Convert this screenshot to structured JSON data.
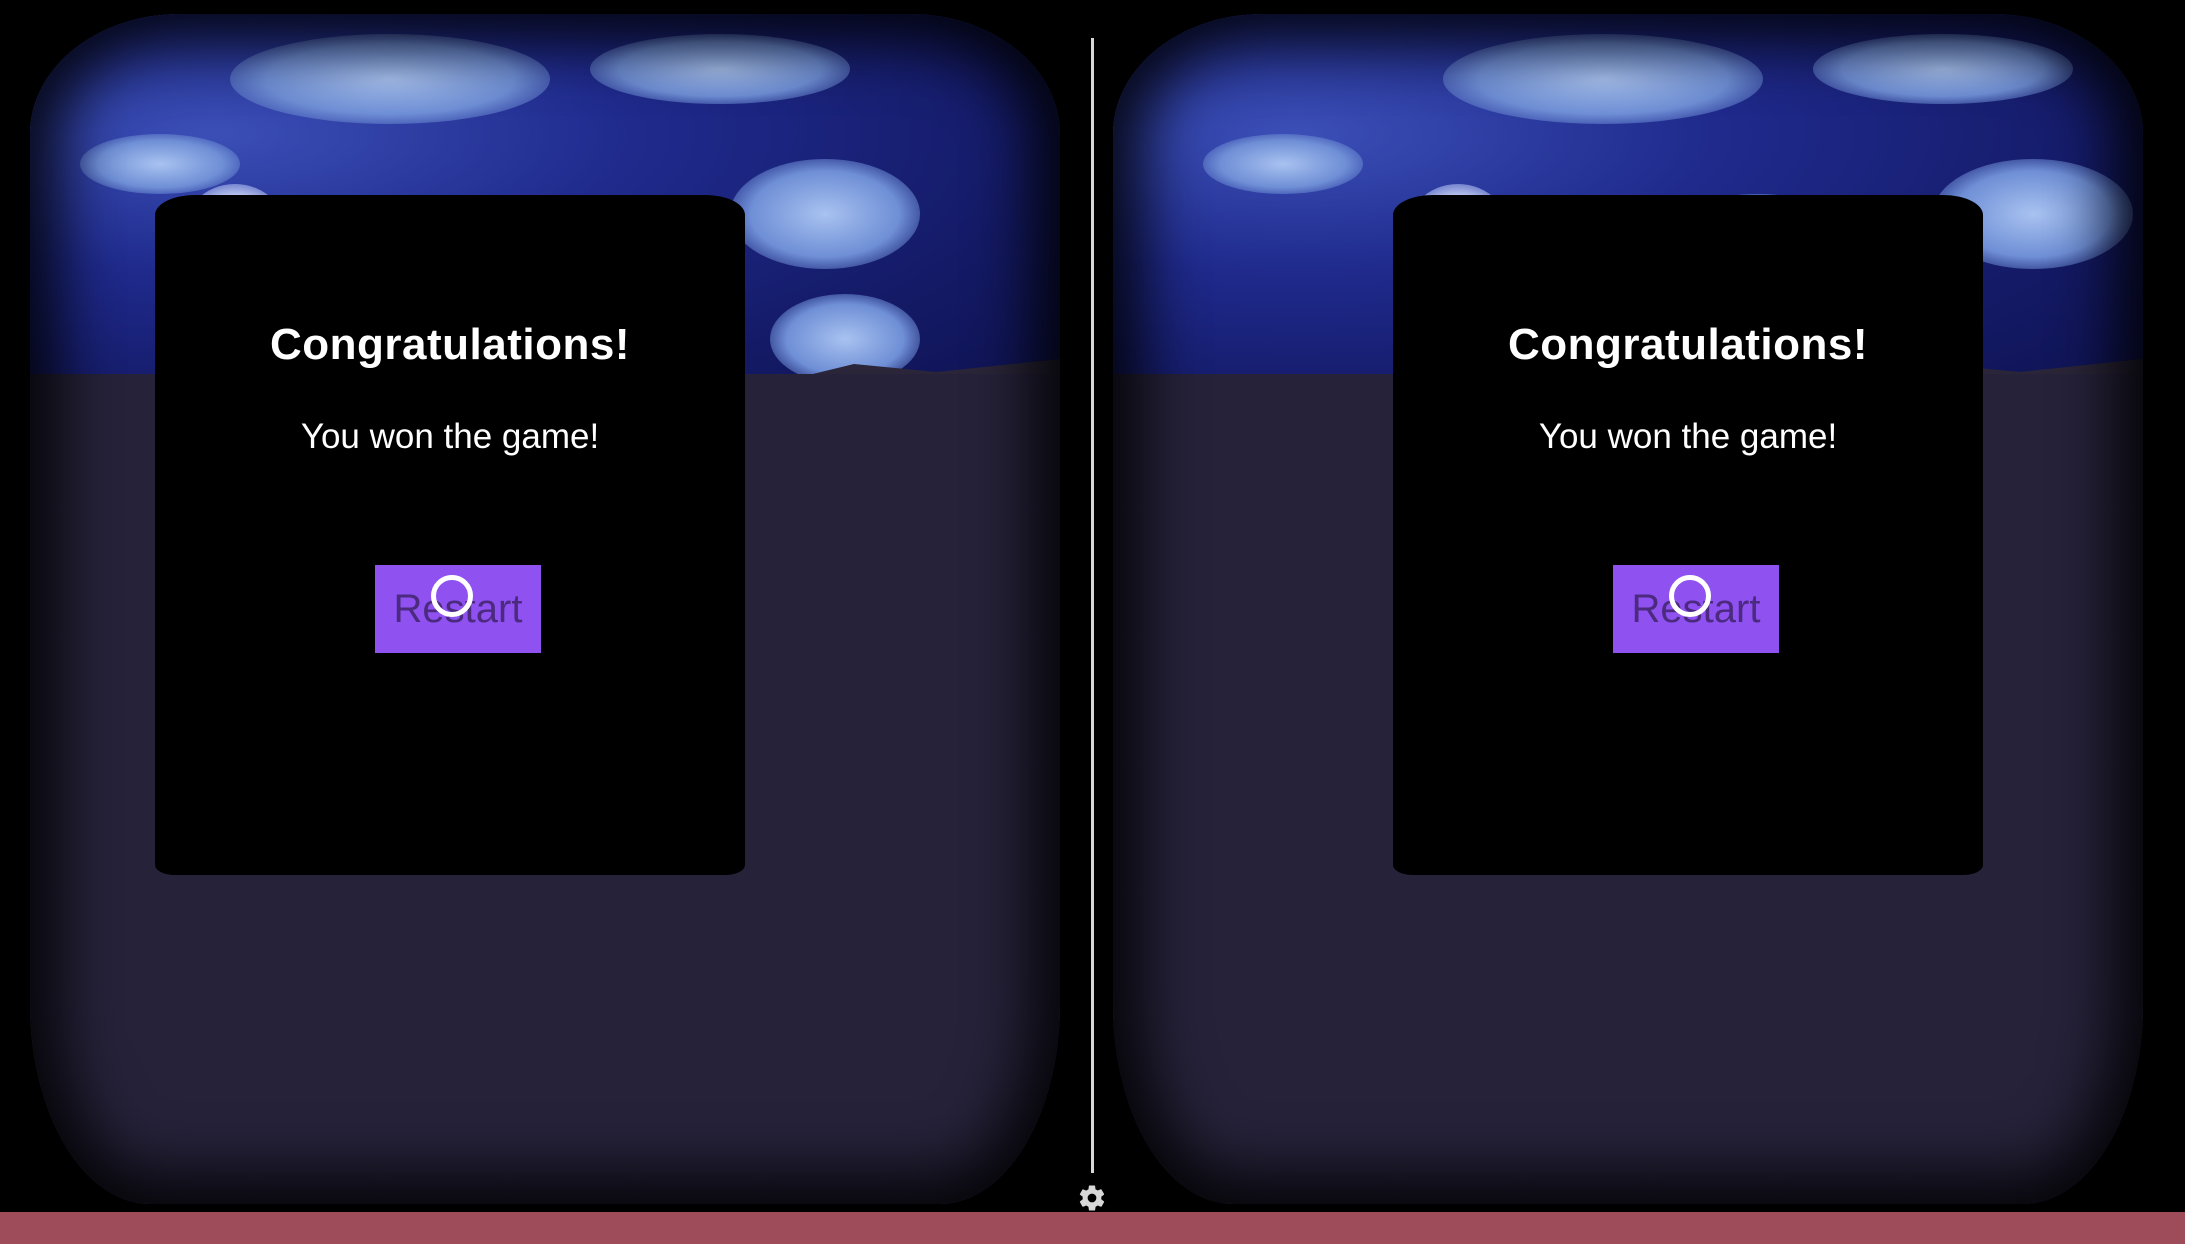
{
  "dialog": {
    "title": "Congratulations!",
    "message": "You won the game!",
    "restart_label": "Restart"
  },
  "colors": {
    "button": "#8f52f0",
    "panel": "#000000",
    "bottom_bar": "#9e4c5a",
    "ground": "#26223a",
    "sky": "#1f2a8c"
  },
  "icons": {
    "settings": "gear-icon",
    "reticle": "gaze-reticle-icon"
  }
}
